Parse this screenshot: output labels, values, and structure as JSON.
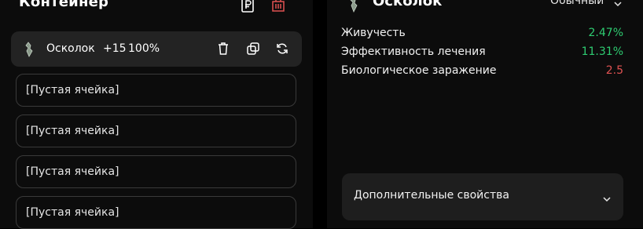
{
  "container": {
    "title": "Контейнер",
    "item": {
      "name": "Осколок",
      "level": "+15",
      "percent": "100%"
    },
    "slots": [
      "[Пустая ячейка]",
      "[Пустая ячейка]",
      "[Пустая ячейка]",
      "[Пустая ячейка]"
    ]
  },
  "details": {
    "title": "Осколок",
    "rarity": "Обычный",
    "stats": [
      {
        "label": "Живучесть",
        "value": "2.47%",
        "color": "#2ecc71"
      },
      {
        "label": "Эффективность лечения",
        "value": "11.31%",
        "color": "#2ecc71"
      },
      {
        "label": "Биологическое заражение",
        "value": "2.5",
        "color": "#e05252"
      }
    ],
    "extra_label": "Дополнительные свойства"
  },
  "colors": {
    "positive": "#2ecc71",
    "negative": "#e05252",
    "delete": "#e05252"
  },
  "icons": [
    "ruble-icon",
    "delete-all-icon",
    "trash-icon",
    "copy-icon",
    "refresh-icon",
    "chevron-down-icon"
  ]
}
